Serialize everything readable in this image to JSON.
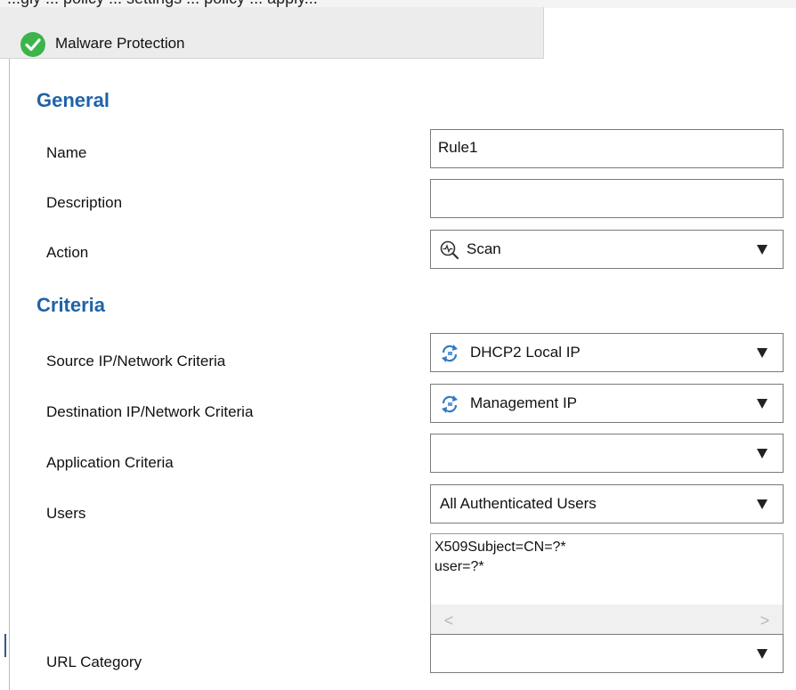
{
  "header_strip": {
    "text": "...gly ... policy ... settings ... policy ... apply..."
  },
  "tab": {
    "title": "Malware Protection",
    "status_icon": "check-circle-icon",
    "status_color": "#3cb44a"
  },
  "sections": {
    "general": "General",
    "criteria": "Criteria"
  },
  "fields": {
    "name": {
      "label": "Name",
      "value": "Rule1"
    },
    "description": {
      "label": "Description",
      "value": ""
    },
    "action": {
      "label": "Action",
      "value": "Scan",
      "icon": "scan-icon"
    },
    "source": {
      "label": "Source IP/Network Criteria",
      "value": "DHCP2 Local IP",
      "icon": "refresh-network-icon"
    },
    "destination": {
      "label": "Destination IP/Network Criteria",
      "value": "Management IP",
      "icon": "refresh-network-icon"
    },
    "application": {
      "label": "Application Criteria",
      "value": ""
    },
    "users": {
      "label": "Users",
      "value": "All Authenticated Users",
      "list": [
        "X509Subject=CN=?*",
        "user=?*"
      ],
      "scroll_left": "<",
      "scroll_right": ">"
    },
    "url_category": {
      "label": "URL Category",
      "value": ""
    }
  },
  "colors": {
    "heading": "#1f63a8",
    "border": "#7a7a7a"
  }
}
